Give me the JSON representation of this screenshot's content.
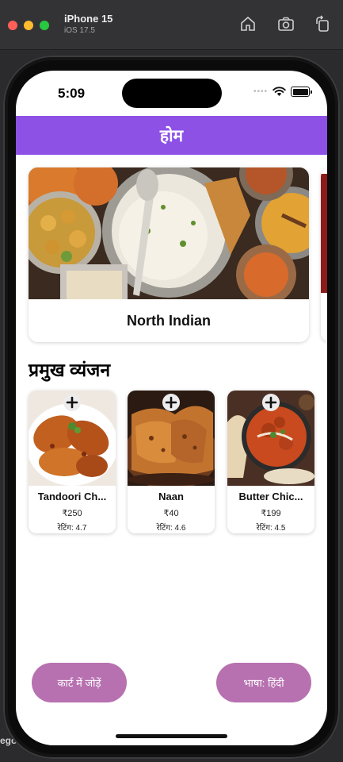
{
  "simulator": {
    "device_name": "iPhone 15",
    "os_version": "iOS 17.5"
  },
  "background_window": {
    "text": "ego"
  },
  "status_bar": {
    "time": "5:09",
    "signal": "••••"
  },
  "header": {
    "title": "होम"
  },
  "categories": [
    {
      "label": "North Indian"
    }
  ],
  "section": {
    "title": "प्रमुख व्यंजन"
  },
  "dishes": [
    {
      "name": "Tandoori Ch...",
      "price": "₹250",
      "rating": "रेटिंग: 4.7"
    },
    {
      "name": "Naan",
      "price": "₹40",
      "rating": "रेटिंग: 4.6"
    },
    {
      "name": "Butter Chic...",
      "price": "₹199",
      "rating": "रेटिंग: 4.5"
    }
  ],
  "buttons": {
    "add_to_cart": "कार्ट में जोड़ें",
    "language": "भाषा: हिंदी"
  },
  "colors": {
    "header_bg": "#8d51e6",
    "button_bg": "#b771b0",
    "card_bg": "#ffffff"
  }
}
